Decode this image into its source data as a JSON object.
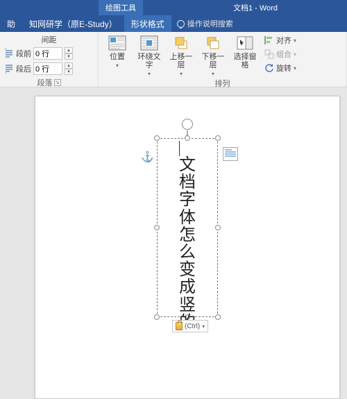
{
  "title": {
    "contextual_tab_group": "绘图工具",
    "document": "文档1 - Word"
  },
  "tabs": {
    "help": "助",
    "estudy": "知网研学（原E-Study）",
    "shape_format": "形状格式",
    "tellme": "操作说明搜索"
  },
  "ribbon": {
    "spacing": {
      "label": "间距",
      "before_label": "段前",
      "before_value": "0 行",
      "after_label": "段后",
      "after_value": "0 行"
    },
    "paragraph_group_label": "段落",
    "arrange": {
      "position": "位置",
      "wrap": "环绕文\n字",
      "bring_forward": "上移一层",
      "send_backward": "下移一层",
      "selection_pane": "选择窗格",
      "align": "对齐",
      "group": "组合",
      "rotate": "旋转",
      "group_label": "排列"
    }
  },
  "document": {
    "textbox_content": "文档字体怎么变成竖的",
    "paste_tag": "(Ctrl)"
  }
}
